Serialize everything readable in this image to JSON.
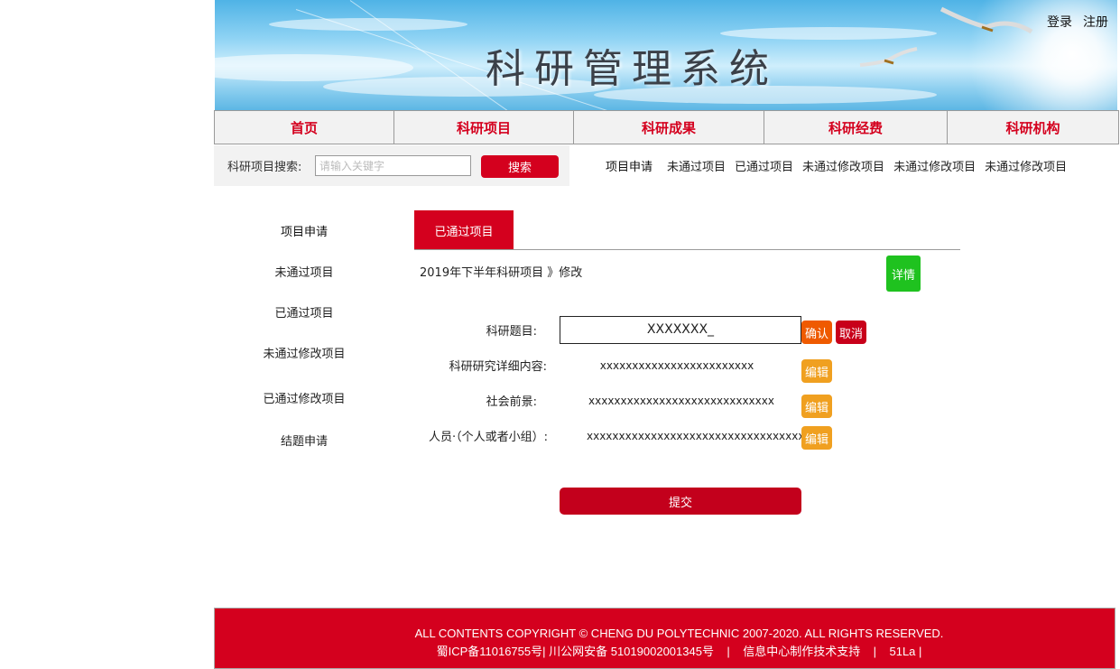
{
  "banner": {
    "title": "科研管理系统"
  },
  "auth": {
    "login": "登录",
    "register": "注册"
  },
  "nav": {
    "items": [
      "首页",
      "科研项目",
      "科研成果",
      "科研经费",
      "科研机构"
    ]
  },
  "search": {
    "label": "科研项目搜索:",
    "placeholder": "请输入关键字",
    "value": "",
    "button": "搜索"
  },
  "quick_links": [
    "项目申请",
    "未通过项目",
    "已通过项目",
    "未通过修改项目",
    "未通过修改项目",
    "未通过修改项目"
  ],
  "sidebar": {
    "items": [
      "项目申请",
      "未通过项目",
      "已通过项目",
      "未通过修改项目",
      "已通过修改项目",
      "结题申请"
    ]
  },
  "tab": {
    "active": "已通过项目"
  },
  "breadcrumb": "2019年下半年科研项目 》修改",
  "detail_button": "详情",
  "form": {
    "title_label": "科研题目:",
    "title_value": "XXXXXXX_",
    "confirm": "确认",
    "cancel": "取消",
    "content_label": "科研研究详细内容:",
    "content_value": "xxxxxxxxxxxxxxxxxxxxxxxx",
    "prospect_label": "社会前景:",
    "prospect_value": "xxxxxxxxxxxxxxxxxxxxxxxxxxxxx",
    "people_label": "人员·（个人或者小组）:",
    "people_value": "xxxxxxxxxxxxxxxxxxxxxxxxxxxxxxxxxx",
    "edit": "编辑",
    "submit": "提交"
  },
  "footer": {
    "line1": "ALL CONTENTS COPYRIGHT © CHENG DU POLYTECHNIC 2007-2020. ALL RIGHTS RESERVED.",
    "line2": "蜀ICP备11016755号| 川公网安备 51019002001345号    |    信息中心制作技术支持    |    51La |"
  },
  "colors": {
    "brand_red": "#d4001e",
    "detail_green": "#1fc21f",
    "edit_orange": "#f0a020",
    "confirm_orange": "#ef5a00"
  }
}
